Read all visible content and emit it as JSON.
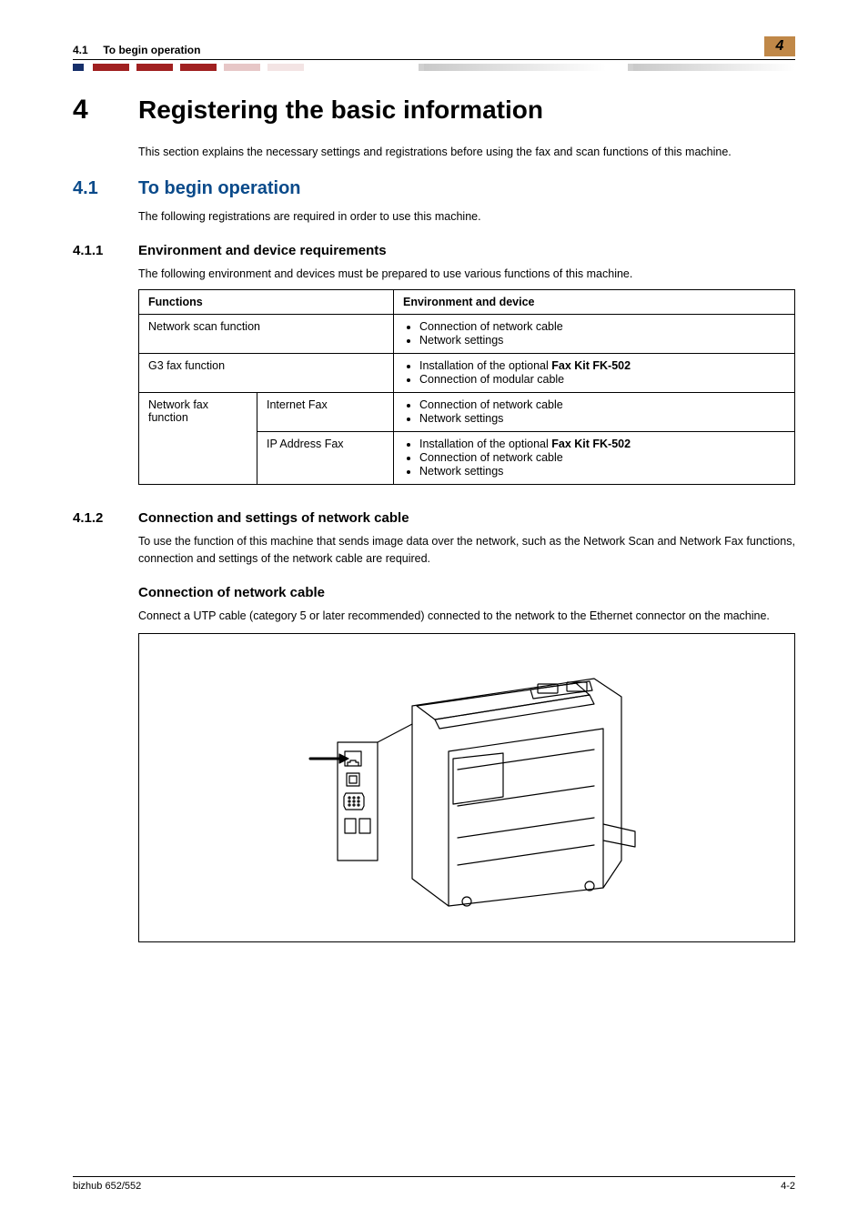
{
  "running_header": {
    "section_number": "4.1",
    "section_title": "To begin operation",
    "badge_number": "4"
  },
  "chapter": {
    "number": "4",
    "title": "Registering the basic information",
    "intro": "This section explains the necessary settings and registrations before using the fax and scan functions of this machine."
  },
  "section_4_1": {
    "number": "4.1",
    "title": "To begin operation",
    "intro": "The following registrations are required in order to use this machine."
  },
  "section_4_1_1": {
    "number": "4.1.1",
    "title": "Environment and device requirements",
    "intro": "The following environment and devices must be prepared to use various functions of this machine.",
    "table": {
      "headers": {
        "functions": "Functions",
        "env": "Environment and device"
      },
      "rows": [
        {
          "function": "Network scan function",
          "subtype": "",
          "env": [
            "Connection of network cable",
            "Network settings"
          ]
        },
        {
          "function": "G3 fax function",
          "subtype": "",
          "env_pre": "Installation of the optional ",
          "env_bold": "Fax Kit FK-502",
          "env_list": [
            "Connection of modular cable"
          ]
        },
        {
          "function": "Network fax function",
          "subtype": "Internet Fax",
          "env": [
            "Connection of network cable",
            "Network settings"
          ]
        },
        {
          "function": "",
          "subtype": "IP Address Fax",
          "env_pre": "Installation of the optional ",
          "env_bold": "Fax Kit FK-502",
          "env_list": [
            "Connection of network cable",
            "Network settings"
          ]
        }
      ]
    }
  },
  "section_4_1_2": {
    "number": "4.1.2",
    "title": "Connection and settings of network cable",
    "intro": "To use the function of this machine that sends image data over the network, such as the Network Scan and Network Fax functions, connection and settings of the network cable are required.",
    "subhead": "Connection of network cable",
    "subpara": "Connect a UTP cable (category 5 or later recommended) connected to the network to the Ethernet connector on the machine."
  },
  "footer": {
    "left": "bizhub 652/552",
    "right": "4-2"
  }
}
